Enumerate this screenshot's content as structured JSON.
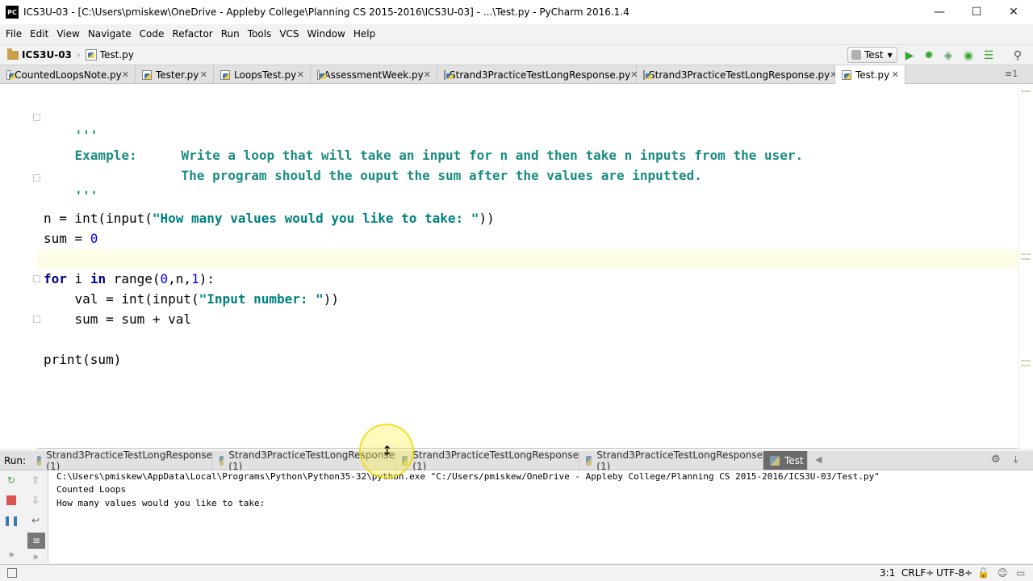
{
  "window": {
    "title": "ICS3U-03 - [C:\\Users\\pmiskew\\OneDrive - Appleby College\\Planning CS 2015-2016\\ICS3U-03] - ...\\Test.py - PyCharm 2016.1.4",
    "logo": "PC",
    "minimize": "—",
    "maximize": "☐",
    "close": "✕"
  },
  "menu": [
    "File",
    "Edit",
    "View",
    "Navigate",
    "Code",
    "Refactor",
    "Run",
    "Tools",
    "VCS",
    "Window",
    "Help"
  ],
  "breadcrumb": {
    "project": "ICS3U-03",
    "file": "Test.py",
    "separator": "›"
  },
  "toolbar": {
    "run_config": "Test",
    "icons": [
      "run-icon",
      "debug-icon",
      "coverage-icon",
      "profile-icon",
      "concurrency-icon",
      "search-icon"
    ]
  },
  "editor_tabs": [
    {
      "label": "CountedLoopsNote.py",
      "active": false
    },
    {
      "label": "Tester.py",
      "active": false
    },
    {
      "label": "LoopsTest.py",
      "active": false
    },
    {
      "label": "AssessmentWeek.py",
      "active": false
    },
    {
      "label": "Strand3PracticeTestLongResponse.py",
      "active": false
    },
    {
      "label": "Strand3PracticeTestLongResponse.py",
      "active": false
    },
    {
      "label": "Test.py",
      "active": true
    }
  ],
  "tabs_overflow": "≡1",
  "code": {
    "doc_open": "'''",
    "example_label": "Example:",
    "example_line1": "Write a loop that will take an input for n and then take n inputs from the user.",
    "example_line2": "The program should the ouput the sum after the values are inputted.",
    "doc_close": "'''",
    "n_line_start": "n = int(input(",
    "n_line_str": "\"How many values would you like to take: \"",
    "n_line_end": "))",
    "sum_line_start": "sum = ",
    "sum_init": "0",
    "for_kw": "for",
    "for_var": " i ",
    "in_kw": "in",
    "for_range_start": " range(",
    "range_0": "0",
    "range_mid": ",n,",
    "range_1": "1",
    "for_range_end": "):",
    "val_line_start": "    val = int(input(",
    "val_line_str": "\"Input number: \"",
    "val_line_end": "))",
    "sum_update": "    sum = sum + val",
    "print_line": "print(sum)"
  },
  "run": {
    "label": "Run:",
    "tabs": [
      {
        "label": "Strand3PracticeTestLongResponse (1)",
        "active": false
      },
      {
        "label": "Strand3PracticeTestLongResponse (1)",
        "active": false
      },
      {
        "label": "Strand3PracticeTestLongResponse (1)",
        "active": false
      },
      {
        "label": "Strand3PracticeTestLongResponse (1)",
        "active": false
      },
      {
        "label": "Test",
        "active": true
      }
    ],
    "console_lines": [
      "C:\\Users\\pmiskew\\AppData\\Local\\Programs\\Python\\Python35-32\\python.exe \"C:/Users/pmiskew/OneDrive - Appleby College/Planning CS 2015-2016/ICS3U-03/Test.py\"",
      "Counted Loops",
      "How many values would you like to take:"
    ]
  },
  "status": {
    "position": "3:1",
    "line_sep": "CRLF÷",
    "encoding": "UTF-8÷"
  }
}
